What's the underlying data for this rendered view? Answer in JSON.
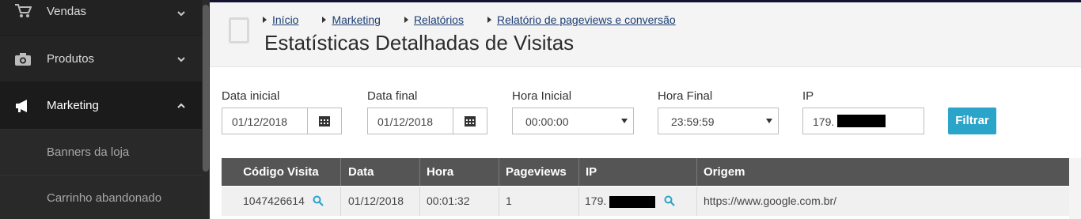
{
  "sidebar": {
    "items": [
      {
        "label": "Vendas",
        "icon": "cart-icon",
        "expanded": false
      },
      {
        "label": "Produtos",
        "icon": "camera-icon",
        "expanded": false
      },
      {
        "label": "Marketing",
        "icon": "megaphone-icon",
        "expanded": true
      }
    ],
    "subitems": [
      {
        "label": "Banners da loja"
      },
      {
        "label": "Carrinho abandonado"
      }
    ]
  },
  "breadcrumb": [
    "Início",
    "Marketing",
    "Relatórios",
    "Relatório de pageviews e conversão"
  ],
  "page_title": "Estatísticas Detalhadas de Visitas",
  "filters": {
    "data_inicial": {
      "label": "Data inicial",
      "value": "01/12/2018"
    },
    "data_final": {
      "label": "Data final",
      "value": "01/12/2018"
    },
    "hora_inicial": {
      "label": "Hora Inicial",
      "value": "00:00:00"
    },
    "hora_final": {
      "label": "Hora Final",
      "value": "23:59:59"
    },
    "ip": {
      "label": "IP",
      "value": "179."
    },
    "button": "Filtrar"
  },
  "table": {
    "columns": [
      "Código Visita",
      "Data",
      "Hora",
      "Pageviews",
      "IP",
      "Origem"
    ],
    "rows": [
      {
        "codigo": "1047426614",
        "data": "01/12/2018",
        "hora": "00:01:32",
        "pageviews": "1",
        "ip": "179.",
        "origem": "https://www.google.com.br/"
      }
    ]
  },
  "colors": {
    "accent": "#2aa4c9",
    "sidebar_bg": "#222222",
    "table_header": "#555555",
    "link": "#1c3d73"
  }
}
